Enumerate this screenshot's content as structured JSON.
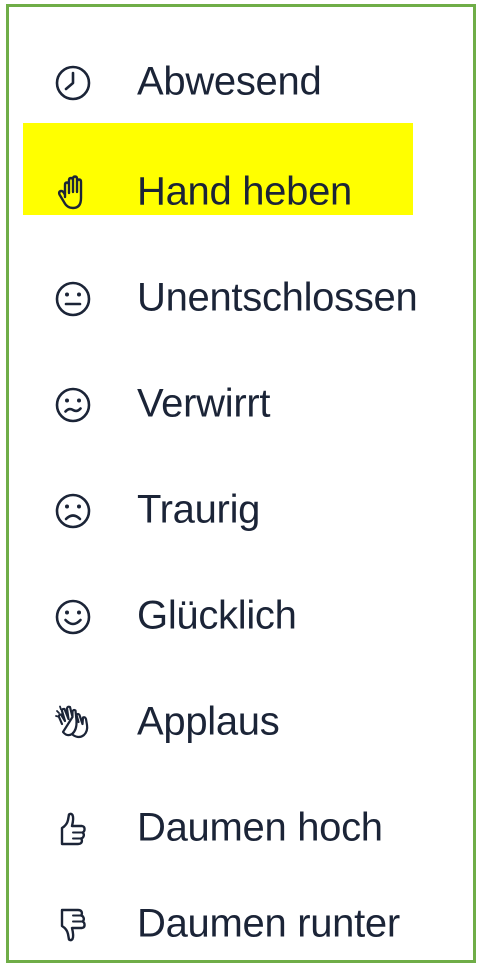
{
  "menu": {
    "highlight_color": "#ffff00",
    "border_color": "#6fad47",
    "items": [
      {
        "label": "Abwesend",
        "icon": "clock-icon"
      },
      {
        "label": "Hand heben",
        "icon": "raised-hand-icon",
        "highlighted": true
      },
      {
        "label": "Unentschlossen",
        "icon": "neutral-face-icon"
      },
      {
        "label": "Verwirrt",
        "icon": "confused-face-icon"
      },
      {
        "label": "Traurig",
        "icon": "sad-face-icon"
      },
      {
        "label": "Glücklich",
        "icon": "happy-face-icon"
      },
      {
        "label": "Applaus",
        "icon": "clapping-hands-icon"
      },
      {
        "label": "Daumen hoch",
        "icon": "thumbs-up-icon"
      },
      {
        "label": "Daumen runter",
        "icon": "thumbs-down-icon"
      }
    ]
  }
}
